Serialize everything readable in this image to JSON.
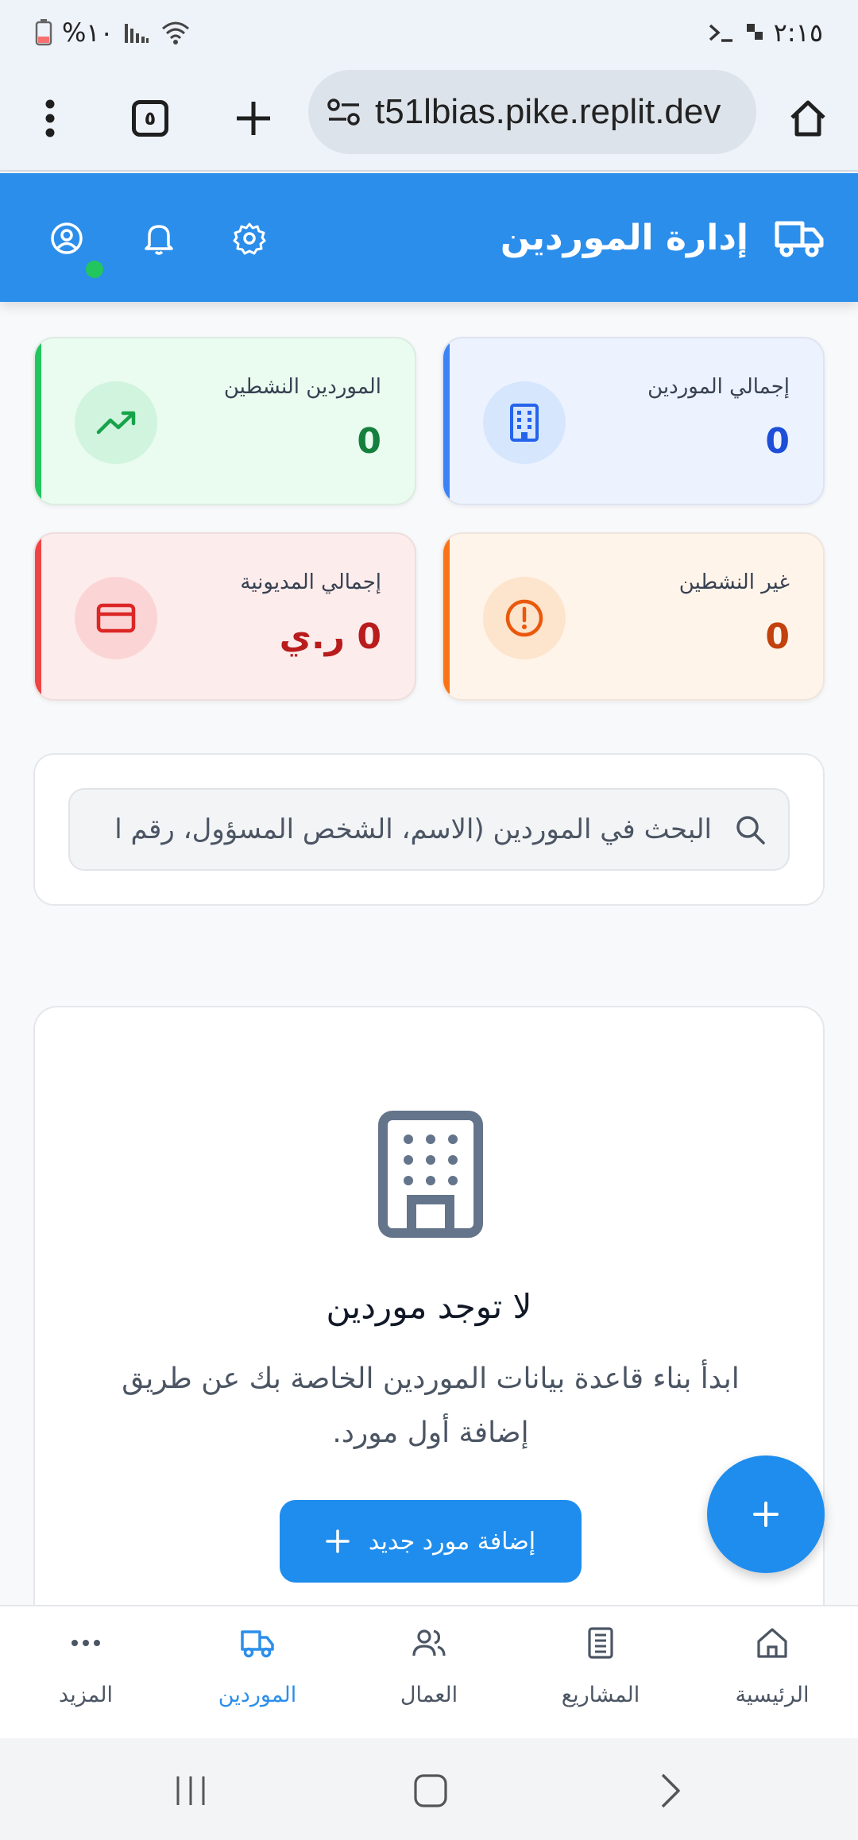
{
  "status_bar": {
    "time": "٢:١٥",
    "battery": "%١٠"
  },
  "browser": {
    "url": "t51lbias.pike.replit.dev",
    "tab_count": "٥"
  },
  "header": {
    "title": "إدارة الموردين"
  },
  "stats": {
    "total_suppliers": {
      "label": "إجمالي الموردين",
      "value": "0",
      "icon": "building-icon"
    },
    "active_suppliers": {
      "label": "الموردين النشطين",
      "value": "0",
      "icon": "trending-up-icon"
    },
    "inactive_suppliers": {
      "label": "غير النشطين",
      "value": "0",
      "icon": "alert-circle-icon"
    },
    "total_debt": {
      "label": "إجمالي المديونية",
      "value": "0 ر.ي",
      "icon": "credit-card-icon"
    }
  },
  "search": {
    "placeholder": "البحث في الموردين (الاسم، الشخص المسؤول، رقم ا"
  },
  "empty_state": {
    "title": "لا توجد موردين",
    "description": "ابدأ بناء قاعدة بيانات الموردين الخاصة بك عن طريق إضافة أول مورد.",
    "button_label": "إضافة مورد جديد"
  },
  "bottom_nav": {
    "items": [
      {
        "label": "المزيد",
        "icon": "more-icon",
        "active": false
      },
      {
        "label": "الموردين",
        "icon": "truck-icon",
        "active": true
      },
      {
        "label": "العمال",
        "icon": "users-icon",
        "active": false
      },
      {
        "label": "المشاريع",
        "icon": "projects-icon",
        "active": false
      },
      {
        "label": "الرئيسية",
        "icon": "home-icon",
        "active": false
      }
    ]
  },
  "colors": {
    "primary": "#2c8eeb",
    "blue": "#3b82f6",
    "green": "#22c55e",
    "orange": "#f97316",
    "red": "#ef4444"
  }
}
